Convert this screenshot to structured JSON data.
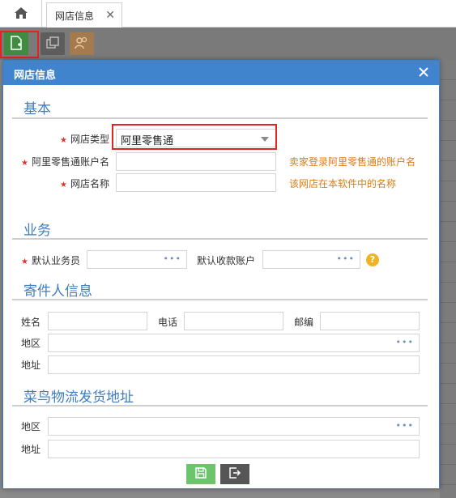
{
  "tab": {
    "label": "网店信息"
  },
  "modal": {
    "title": "网店信息",
    "sections": {
      "basic": "基本",
      "business": "业务",
      "sender": "寄件人信息",
      "cainiao": "菜鸟物流发货地址"
    },
    "basic": {
      "shop_type_label": "网店类型",
      "shop_type_value": "阿里零售通",
      "account_label": "阿里零售通账户名",
      "account_hint": "卖家登录阿里零售通的账户名",
      "shop_name_label": "网店名称",
      "shop_name_hint": "该网店在本软件中的名称"
    },
    "business": {
      "salesperson_label": "默认业务员",
      "receive_account_label": "默认收款账户"
    },
    "sender": {
      "name_label": "姓名",
      "phone_label": "电话",
      "zip_label": "邮编",
      "region_label": "地区",
      "address_label": "地址"
    },
    "cainiao": {
      "region_label": "地区",
      "address_label": "地址"
    },
    "ellipsis": "•••",
    "help": "?"
  }
}
